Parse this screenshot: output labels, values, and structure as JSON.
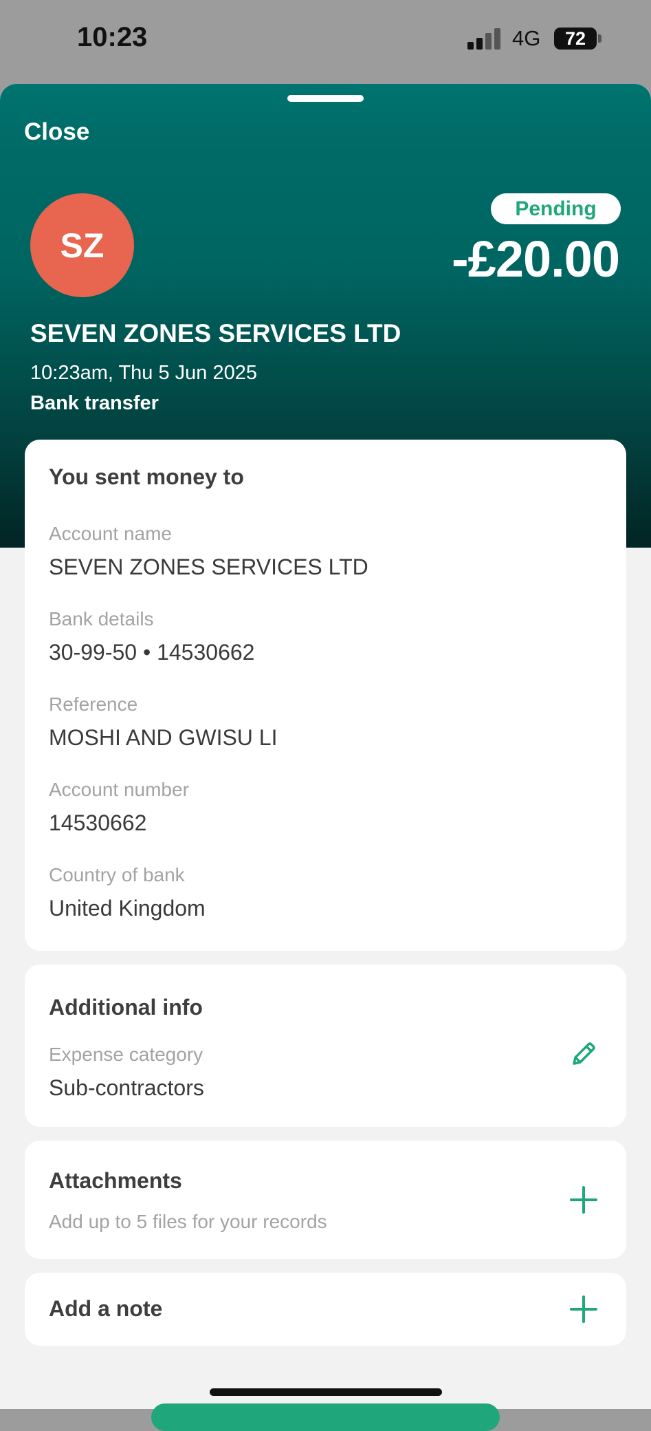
{
  "status_bar": {
    "time": "10:23",
    "network": "4G",
    "battery": "72"
  },
  "header": {
    "close_label": "Close",
    "avatar_initials": "SZ",
    "status_badge": "Pending",
    "amount": "-£20.00",
    "merchant": "SEVEN ZONES SERVICES LTD",
    "datetime": "10:23am, Thu 5 Jun 2025",
    "method": "Bank transfer"
  },
  "details": {
    "title": "You sent money to",
    "fields": [
      {
        "label": "Account name",
        "value": "SEVEN ZONES SERVICES LTD"
      },
      {
        "label": "Bank details",
        "value": "30-99-50 • 14530662"
      },
      {
        "label": "Reference",
        "value": "MOSHI AND GWISU LI"
      },
      {
        "label": "Account number",
        "value": "14530662"
      },
      {
        "label": "Country of bank",
        "value": "United Kingdom"
      }
    ]
  },
  "additional": {
    "title": "Additional info",
    "label": "Expense category",
    "value": "Sub-contractors",
    "icon": "pencil-icon"
  },
  "attachments": {
    "title": "Attachments",
    "subtitle": "Add up to 5 files for your records",
    "icon": "plus-icon"
  },
  "note": {
    "title": "Add a note",
    "icon": "plus-icon"
  },
  "colors": {
    "brand": "#006b67",
    "accent": "#1fa67a",
    "avatar": "#e8654f"
  }
}
